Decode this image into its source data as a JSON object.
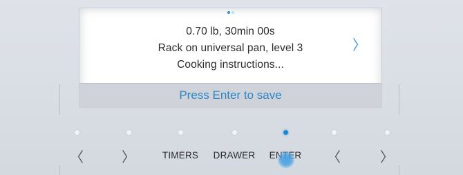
{
  "screen": {
    "pagination": {
      "total": 2,
      "current": 1
    },
    "lines": [
      "0.70 lb, 30min 00s",
      "Rack on universal pan, level 3",
      "Cooking instructions..."
    ],
    "next_icon": "chevron-right-icon",
    "next_glyph": "〉",
    "save_prompt": "Press Enter to save"
  },
  "controls": [
    {
      "id": "left-1",
      "icon": "chevron-left-icon",
      "glyph": "〈",
      "label": "",
      "lit": false
    },
    {
      "id": "right-1",
      "icon": "chevron-right-icon",
      "glyph": "〉",
      "label": "",
      "lit": false
    },
    {
      "id": "timers",
      "icon": "",
      "glyph": "",
      "label": "TIMERS",
      "lit": false
    },
    {
      "id": "drawer",
      "icon": "",
      "glyph": "",
      "label": "DRAWER",
      "lit": false
    },
    {
      "id": "enter",
      "icon": "",
      "glyph": "",
      "label": "ENTER",
      "lit": true
    },
    {
      "id": "left-2",
      "icon": "chevron-left-icon",
      "glyph": "〈",
      "label": "",
      "lit": false
    },
    {
      "id": "right-2",
      "icon": "chevron-right-icon",
      "glyph": "〉",
      "label": "",
      "lit": false
    }
  ],
  "colors": {
    "accent": "#2d8fd0",
    "indicator_active": "#1f87d0",
    "indicator_idle": "#f1f3f6",
    "panel": "#dcdfe5",
    "screen_bg": "#ffffff",
    "save_bar_bg": "#cfd2d8"
  }
}
